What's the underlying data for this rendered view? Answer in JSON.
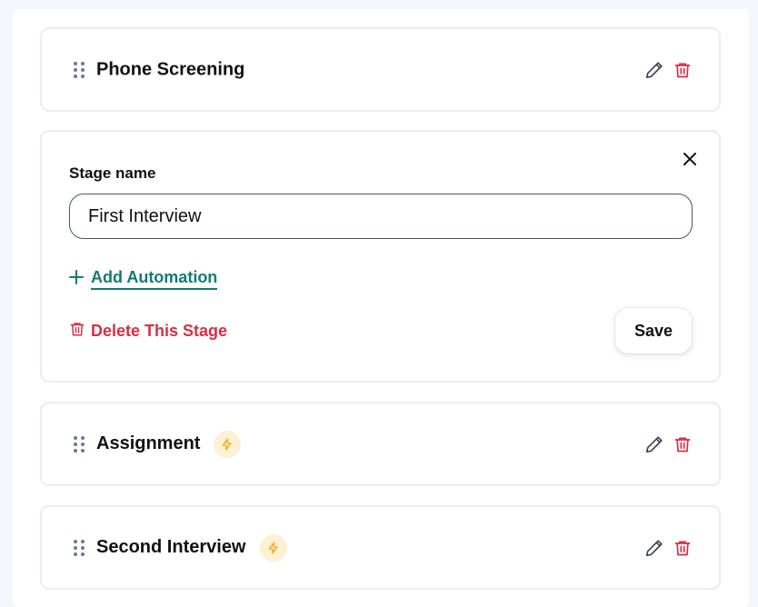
{
  "stages": [
    {
      "id": "phone",
      "title": "Phone Screening",
      "has_automation": false
    },
    {
      "id": "assignment",
      "title": "Assignment",
      "has_automation": true
    },
    {
      "id": "second",
      "title": "Second Interview",
      "has_automation": true
    }
  ],
  "editor": {
    "label": "Stage name",
    "value": "First Interview",
    "add_automation": "Add Automation",
    "delete_stage": "Delete This Stage",
    "save": "Save"
  },
  "colors": {
    "accent_teal": "#137a73",
    "danger_red": "#d72f44",
    "automation_orange": "#f3a21b",
    "automation_bg": "#fdf1d3"
  },
  "icons": {
    "drag": "drag-handle-icon",
    "edit": "pencil-icon",
    "delete": "trash-icon",
    "close": "close-icon",
    "add": "plus-icon",
    "automation": "lightning-bolt-icon"
  }
}
